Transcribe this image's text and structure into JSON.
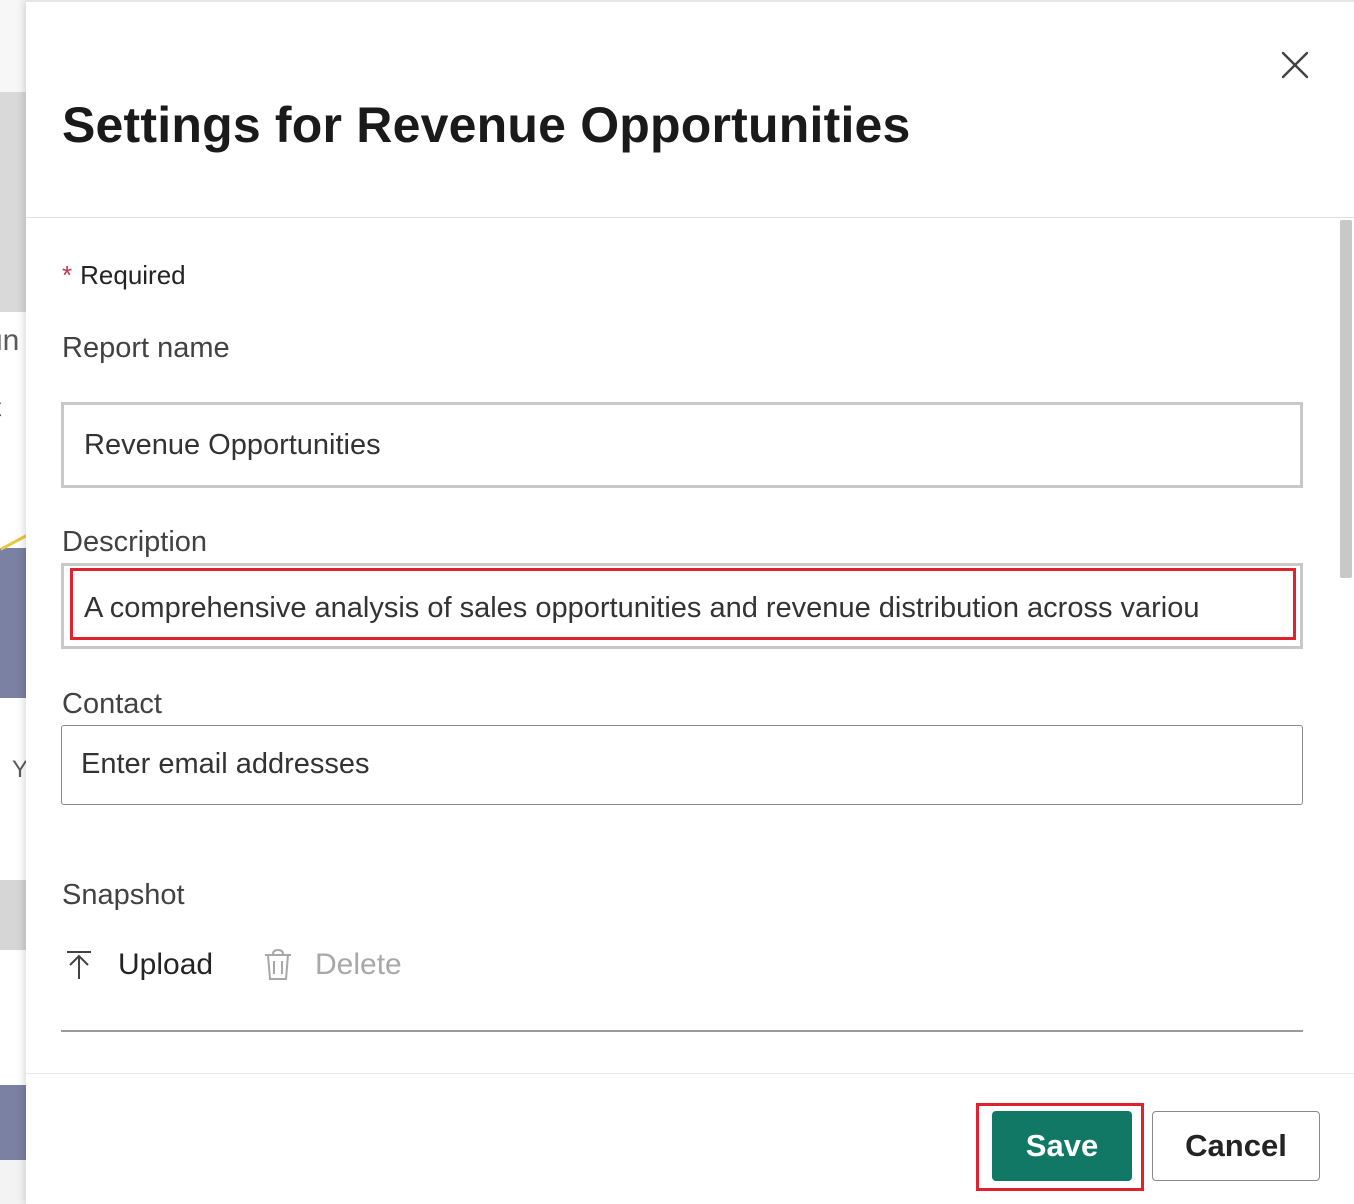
{
  "background": {
    "fragment_1": "un",
    "fragment_2": "t",
    "fragment_3": "Y"
  },
  "dialog": {
    "title": "Settings for Revenue Opportunities",
    "close_icon": "close-icon",
    "required_star": "*",
    "required_label": "Required",
    "fields": {
      "report_name": {
        "label": "Report name",
        "value": "Revenue Opportunities"
      },
      "description": {
        "label": "Description",
        "value": "A comprehensive analysis of sales opportunities and revenue distribution across variou"
      },
      "contact": {
        "label": "Contact",
        "placeholder": "Enter email addresses"
      }
    },
    "snapshot": {
      "label": "Snapshot",
      "upload_label": "Upload",
      "upload_icon": "upload-icon",
      "delete_label": "Delete",
      "delete_icon": "trash-icon"
    },
    "buttons": {
      "save": "Save",
      "cancel": "Cancel"
    }
  },
  "colors": {
    "primary": "#117865",
    "highlight": "#e0212e",
    "required": "#c4314b"
  }
}
